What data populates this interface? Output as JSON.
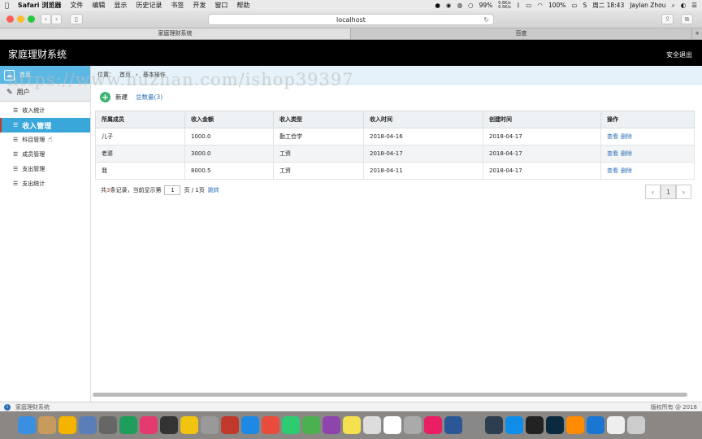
{
  "menubar": {
    "app": "Safari 浏览器",
    "items": [
      "文件",
      "编辑",
      "显示",
      "历史记录",
      "书签",
      "开发",
      "窗口",
      "帮助"
    ],
    "battery": "99%",
    "net_up": "0.6K/s",
    "net_down": "0.5K/s",
    "battery2": "100%",
    "clock": "周二 18:43",
    "user": "Jaylan Zhou"
  },
  "browser": {
    "url": "localhost",
    "tabs": [
      "家庭理财系统",
      "百度"
    ]
  },
  "app": {
    "title": "家庭理财系统",
    "logout": "安全退出"
  },
  "sidebar": {
    "home": "首页",
    "user": "用户",
    "items": [
      "收入统计",
      "收入管理",
      "科目管理",
      "成员管理",
      "支出管理",
      "支出统计"
    ]
  },
  "breadcrumb": {
    "location": "位置：",
    "home": "首页",
    "sep": "›",
    "current": "基本操作"
  },
  "actions": {
    "new": "新建",
    "total": "总数量(3)"
  },
  "table": {
    "headers": [
      "所属成员",
      "收入金额",
      "收入类型",
      "收入时间",
      "创建时间",
      "操作"
    ],
    "rows": [
      [
        "儿子",
        "1000.0",
        "勤工俭学",
        "2018-04-16",
        "2018-04-17"
      ],
      [
        "老婆",
        "3000.0",
        "工资",
        "2018-04-17",
        "2018-04-17"
      ],
      [
        "我",
        "8000.5",
        "工资",
        "2018-04-11",
        "2018-04-17"
      ]
    ],
    "view": "查看",
    "delete": "删除"
  },
  "pager": {
    "prefix": "共",
    "count": "3",
    "mid": "条记录，当前显示第",
    "page": "1",
    "suffix": "页 / 1页",
    "jump": "跳转",
    "prev": "‹",
    "current": "1",
    "next": "›"
  },
  "status": {
    "left": "家庭理财系统",
    "right": "版权所有 @ 2018"
  },
  "watermark": "https://www.huzhan.com/ishop39397",
  "dock": [
    "finder",
    "notes",
    "photos",
    "preview",
    "launchpad",
    "pycharm",
    "intellij",
    "terminal",
    "squirrel",
    "storage",
    "redis",
    "safari",
    "alarm",
    "wechat",
    "chrome",
    "axure",
    "notes",
    "stickies",
    "calendar",
    "photos2",
    "music",
    "word",
    "prefs",
    "baidu",
    "teamviewer",
    "qq",
    "photoshop",
    "sublime",
    "edge",
    "docs",
    "trash"
  ]
}
